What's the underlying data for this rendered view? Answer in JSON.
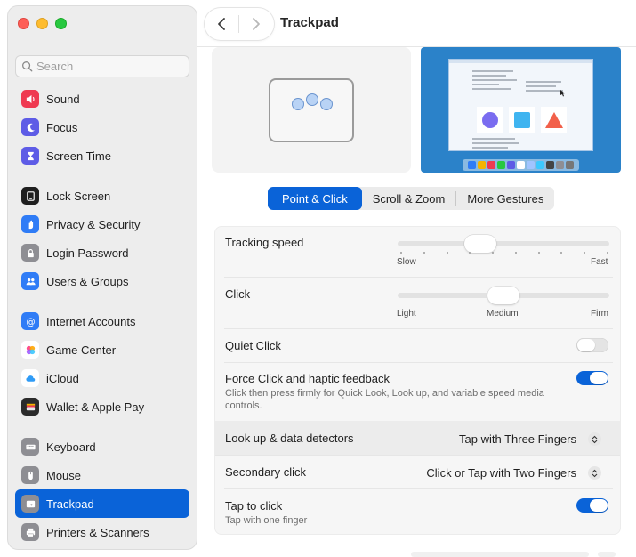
{
  "window": {
    "title": "Trackpad"
  },
  "search": {
    "placeholder": "Search"
  },
  "sidebar": {
    "items": [
      {
        "label": "Sound",
        "icon": "speaker-icon",
        "color": "#ef3a51"
      },
      {
        "label": "Focus",
        "icon": "moon-icon",
        "color": "#5e5ce6"
      },
      {
        "label": "Screen Time",
        "icon": "hourglass-icon",
        "color": "#5e5ce6"
      },
      {
        "label": "Lock Screen",
        "icon": "lock-screen-icon",
        "color": "#1f1f1f"
      },
      {
        "label": "Privacy & Security",
        "icon": "hand-icon",
        "color": "#2f7cf6"
      },
      {
        "label": "Login Password",
        "icon": "lock-icon",
        "color": "#8e8e93"
      },
      {
        "label": "Users & Groups",
        "icon": "users-icon",
        "color": "#2f7cf6"
      },
      {
        "label": "Internet Accounts",
        "icon": "at-icon",
        "color": "#2f7cf6"
      },
      {
        "label": "Game Center",
        "icon": "game-center-icon",
        "color": "#ffffff"
      },
      {
        "label": "iCloud",
        "icon": "cloud-icon",
        "color": "#ffffff"
      },
      {
        "label": "Wallet & Apple Pay",
        "icon": "wallet-icon",
        "color": "#2b2b2b"
      },
      {
        "label": "Keyboard",
        "icon": "keyboard-icon",
        "color": "#8e8e93"
      },
      {
        "label": "Mouse",
        "icon": "mouse-icon",
        "color": "#8e8e93"
      },
      {
        "label": "Trackpad",
        "icon": "trackpad-icon",
        "color": "#8e8e93"
      },
      {
        "label": "Printers & Scanners",
        "icon": "printer-icon",
        "color": "#8e8e93"
      }
    ],
    "selected": "Trackpad"
  },
  "tabs": [
    {
      "label": "Point & Click",
      "active": true
    },
    {
      "label": "Scroll & Zoom",
      "active": false
    },
    {
      "label": "More Gestures",
      "active": false
    }
  ],
  "settings": {
    "tracking_speed": {
      "label": "Tracking speed",
      "min_label": "Slow",
      "max_label": "Fast",
      "value": 0.37
    },
    "click": {
      "label": "Click",
      "left_label": "Light",
      "mid_label": "Medium",
      "right_label": "Firm",
      "value": 0.5
    },
    "quiet_click": {
      "label": "Quiet Click",
      "enabled": false
    },
    "force_click": {
      "label": "Force Click and haptic feedback",
      "description": "Click then press firmly for Quick Look, Look up, and variable speed media controls.",
      "enabled": true
    },
    "look_up": {
      "label": "Look up & data detectors",
      "value": "Tap with Three Fingers"
    },
    "secondary_click": {
      "label": "Secondary click",
      "value": "Click or Tap with Two Fingers"
    },
    "tap_to_click": {
      "label": "Tap to click",
      "description": "Tap with one finger",
      "enabled": true
    }
  },
  "colors": {
    "accent": "#0a63d8",
    "sidebar_bg": "#ededed",
    "panel_bg": "#f6f6f6"
  }
}
